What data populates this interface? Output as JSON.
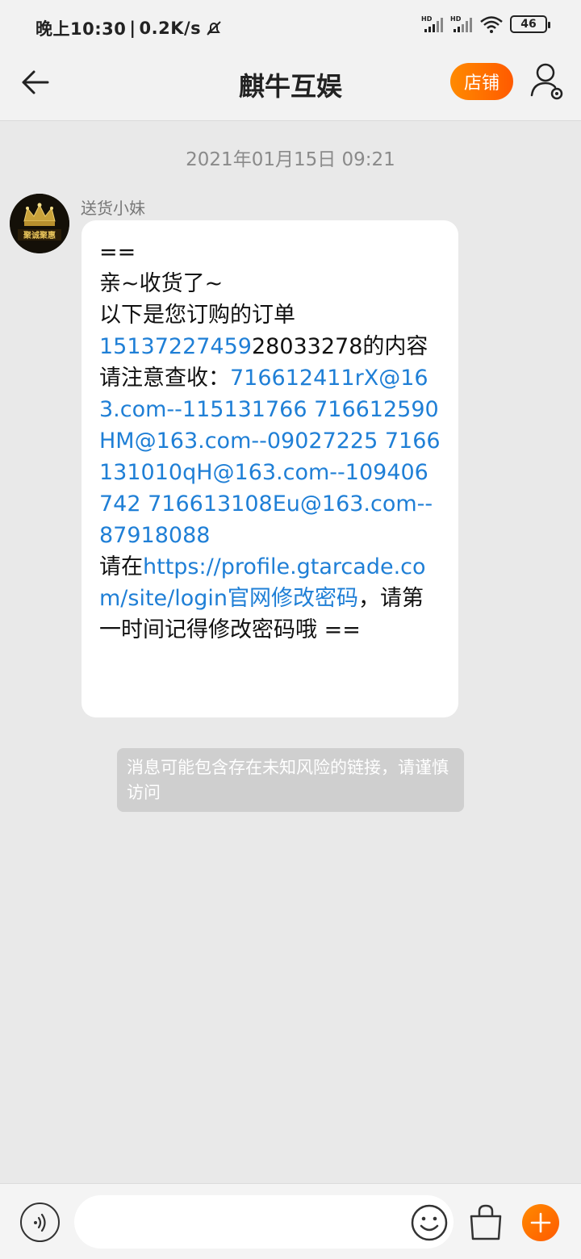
{
  "status_bar": {
    "time": "晚上10:30",
    "speed": "0.2K/s",
    "signal_label_1": "HD",
    "signal_label_2": "HD",
    "battery": "46"
  },
  "header": {
    "title": "麒牛互娱",
    "shop_label": "店铺"
  },
  "chat": {
    "timestamp": "2021年01月15日 09:21",
    "sender": "送货小妹",
    "avatar_text": "聚诚聚惠",
    "message": {
      "l1": "==",
      "l2": "亲~收货了~",
      "l3": "以下是您订购的订单",
      "order_link": "15137227459",
      "order_rest": "28033278的内容",
      "check_prefix": "请注意查收：",
      "accounts": "716612411rX@163.com--115131766 716612590HM@163.com--09027225 7166131010qH@163.com--109406742 716613108Eu@163.com--87918088",
      "change_prefix": "请在",
      "change_link": "https://profile.gtarcade.com/site/login官网修改密码",
      "change_suffix": "，请第一时间记得修改密码哦 =="
    },
    "warning": "消息可能包含存在未知风险的链接，请谨慎访问"
  },
  "input_bar": {
    "placeholder": ""
  },
  "colors": {
    "accent": "#ff6a00",
    "link": "#1f7fd6",
    "background": "#e9e9e9"
  }
}
